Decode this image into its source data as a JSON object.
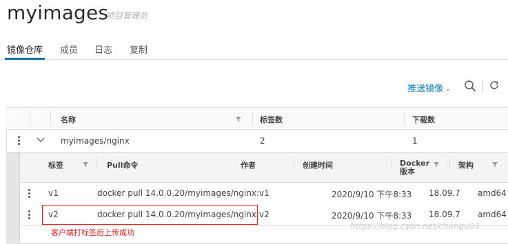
{
  "header": {
    "title": "myimages",
    "role": "项目管理员"
  },
  "tabs": [
    {
      "label": "镜像仓库",
      "active": true
    },
    {
      "label": "成员",
      "active": false
    },
    {
      "label": "日志",
      "active": false
    },
    {
      "label": "复制",
      "active": false
    }
  ],
  "toolbar": {
    "push_label": "推送镜像",
    "push_chevron": "⌄"
  },
  "repo_table": {
    "columns": [
      "名称",
      "标签数",
      "下载数"
    ],
    "rows": [
      {
        "name": "myimages/nginx",
        "tags": "2",
        "pulls": "1"
      }
    ]
  },
  "tag_table": {
    "columns": {
      "tag": "标签",
      "pull": "Pull命令",
      "author": "作者",
      "created": "创建时间",
      "docker_version": "Docker\n版本",
      "arch": "架构"
    },
    "rows": [
      {
        "tag": "v1",
        "pull": "docker pull 14.0.0.20/myimages/nginx:v1",
        "created": "2020/9/10 下午8:33",
        "docker_version": "18.09.7",
        "arch": "amd64"
      },
      {
        "tag": "v2",
        "pull": "docker pull 14.0.0.20/myimages/nginx:v2",
        "created": "2020/9/10 下午8:33",
        "docker_version": "18.09.7",
        "arch": "amd64"
      }
    ]
  },
  "annotation": {
    "caption": "客户端打标签后上传成功"
  },
  "watermark": "https://blog.csdn.net/chengu04",
  "colors": {
    "accent": "#0079b8",
    "highlight": "#e02020",
    "caption": "#e02020"
  }
}
